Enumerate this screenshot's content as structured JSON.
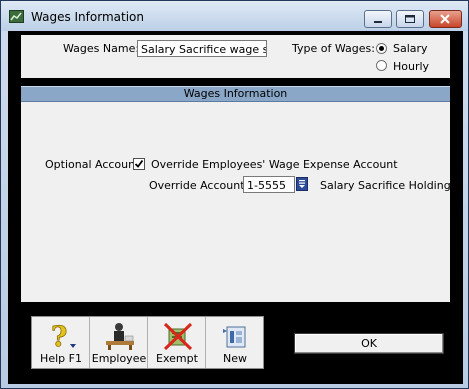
{
  "window": {
    "title": "Wages Information",
    "controls": {
      "minimize_icon": "minimize-icon",
      "maximize_icon": "maximize-icon",
      "close_icon": "close-icon"
    }
  },
  "header": {
    "wages_name_label": "Wages Name:",
    "wages_name_value": "Salary Sacrifice wage split",
    "type_of_wages_label": "Type of Wages:",
    "type_options": [
      {
        "label": "Salary",
        "checked": true
      },
      {
        "label": "Hourly",
        "checked": false
      }
    ]
  },
  "section": {
    "title": "Wages Information",
    "optional_account_label": "Optional Account:",
    "override_checkbox_label": "Override Employees' Wage Expense Account",
    "override_checked": true,
    "override_account_label": "Override Account:",
    "override_account_value": "1-5555",
    "override_account_name": "Salary Sacrifice Holding"
  },
  "toolbar": {
    "items": [
      {
        "label": "Help F1",
        "icon": "help-icon"
      },
      {
        "label": "Employee",
        "icon": "employee-icon"
      },
      {
        "label": "Exempt",
        "icon": "exempt-icon"
      },
      {
        "label": "New",
        "icon": "new-icon"
      }
    ]
  },
  "footer": {
    "ok_label": "OK"
  }
}
